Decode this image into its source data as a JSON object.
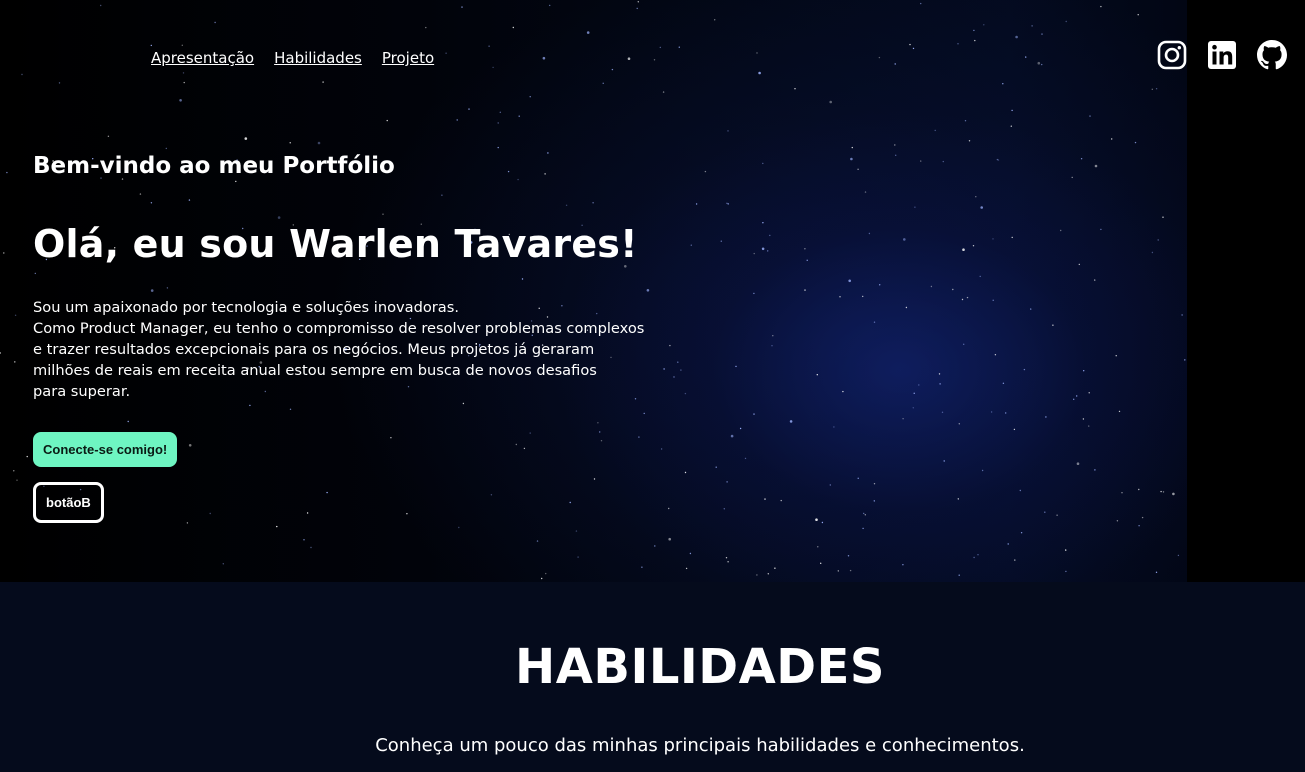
{
  "nav": {
    "items": [
      "Apresentação",
      "Habilidades",
      "Projeto"
    ]
  },
  "socials": {
    "items": [
      "instagram-icon",
      "linkedin-icon",
      "github-icon"
    ]
  },
  "hero": {
    "subtitle": "Bem-vindo ao meu Portfólio",
    "title": "Olá, eu sou Warlen Tavares!",
    "description_lines": [
      "Sou um apaixonado por tecnologia e soluções inovadoras.",
      "Como Product Manager, eu tenho o compromisso de resolver problemas complexos",
      "e trazer resultados excepcionais para os negócios. Meus projetos já geraram",
      "milhões de reais em receita anual estou sempre em busca de novos desafios",
      "para superar."
    ],
    "primary_button": "Conecte-se comigo!",
    "secondary_button": "botãoB"
  },
  "skills": {
    "title": "HABILIDADES",
    "description": "Conheça um pouco das minhas principais habilidades e conhecimentos."
  },
  "colors": {
    "accent": "#6ef5c2",
    "hero_bg": "#000000",
    "skills_bg": "#050b1c",
    "text": "#ffffff"
  }
}
